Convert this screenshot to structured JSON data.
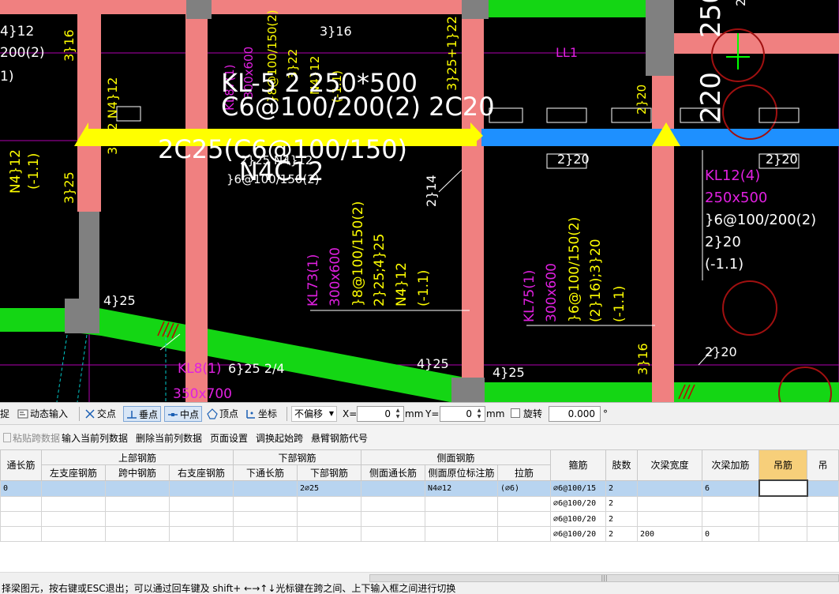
{
  "canvas": {
    "labels": {
      "tl_1": "4}12",
      "tl_2": "200(2)",
      "tl_3": "1)",
      "col1_top": "3}16",
      "col2_top_a": "3}16",
      "col3_top": "3}25+1}22",
      "n4_12_v": "N4}12",
      "n4_12_v2": "3}22 N4}12",
      "left_n4_a": "N4}12",
      "left_n4_b": "(-1.1)",
      "left_3_25": "3}25",
      "ll1": "LL1",
      "kl_main_1": "KL-5 2 250*500",
      "kl_main_2": "C6@100/200(2) 2C20",
      "kl_main_3": "2C25(C6@100/150)",
      "kl_main_4": "N4C12",
      "kl_small_1": "2}25 N4}12",
      "kl_small_2": "}6@100/150(2)",
      "kl7_1": "KL87(1)",
      "kl7_2": "300x600",
      "kl7_3": "}8@100/150(2)",
      "kl7_4": "3}22",
      "kl7_5": "N4}12",
      "kl7_6": "(-1.1)",
      "r220": "220",
      "r250": "250",
      "r2_20_top": "2}20,2}20",
      "mid_2_20": "2}20",
      "right_2_20": "2}20",
      "kl12_1": "KL12(4)",
      "kl12_2": "250x500",
      "kl12_3": "}6@100/200(2)",
      "kl12_4": "2}20",
      "kl12_5": "(-1.1)",
      "lbl_2_14": "2}14",
      "kl73_1": "KL73(1)",
      "kl73_2": "300x600",
      "kl73_3": "}8@100/150(2)",
      "kl73_4": "2}25;4}25",
      "kl73_5": "N4}12",
      "kl73_6": "(-1.1)",
      "kl75_1": "KL75(1)",
      "kl75_2": "300x600",
      "kl75_3": "}6@100/150(2)",
      "kl75_4": "(2}16);3}20",
      "kl75_5": "(-1.1)",
      "r3_16": "3}16",
      "br_2_20": "2}20",
      "bl_4_25": "4}25",
      "kl8_1": "KL8(1)",
      "kl8_2": "350x700",
      "lbl_6_25": "6}25 2/4",
      "lbl_4_25_mid": "4}25",
      "lbl_4_25_r": "4}25"
    }
  },
  "toolbar": {
    "items": [
      {
        "label": "捉",
        "icon": "snap-icon"
      },
      {
        "label": "动态输入",
        "icon": "dynamic-input-icon"
      },
      {
        "label": "交点",
        "icon": "intersection-icon"
      },
      {
        "label": "垂点",
        "icon": "perpendicular-icon"
      },
      {
        "label": "中点",
        "icon": "midpoint-icon"
      },
      {
        "label": "顶点",
        "icon": "vertex-icon"
      },
      {
        "label": "坐标",
        "icon": "coordinate-icon"
      }
    ],
    "offset_mode": "不偏移",
    "x_label": "X=",
    "x_value": "0",
    "y_label": "Y=",
    "y_value": "0",
    "unit_mm": "mm",
    "rotate_label": "旋转",
    "rotate_value": "0.000",
    "degree": "°"
  },
  "menubar": {
    "items": [
      {
        "label": "粘贴跨数据",
        "enabled": false
      },
      {
        "label": "输入当前列数据",
        "enabled": true
      },
      {
        "label": "删除当前列数据",
        "enabled": true
      },
      {
        "label": "页面设置",
        "enabled": true
      },
      {
        "label": "调换起始跨",
        "enabled": true
      },
      {
        "label": "悬臂钢筋代号",
        "enabled": true
      }
    ]
  },
  "grid": {
    "groups": {
      "top": "上部钢筋",
      "bottom": "下部钢筋",
      "side": "侧面钢筋"
    },
    "columns": {
      "c0": "通长筋",
      "c1": "左支座钢筋",
      "c2": "跨中钢筋",
      "c3": "右支座钢筋",
      "c4": "下通长筋",
      "c5": "下部钢筋",
      "c6": "侧面通长筋",
      "c7": "侧面原位标注筋",
      "c8": "拉筋",
      "c9": "箍筋",
      "c10": "肢数",
      "c11": "次梁宽度",
      "c12": "次梁加筋",
      "c13": "吊筋",
      "c14": "吊"
    },
    "rows": [
      [
        "0",
        "",
        "",
        "",
        "",
        "2⌀25",
        "",
        "N4⌀12",
        "(⌀6)",
        "⌀6@100/15",
        "2",
        "",
        "6",
        "",
        ""
      ],
      [
        "",
        "",
        "",
        "",
        "",
        "",
        "",
        "",
        "",
        "⌀6@100/20",
        "2",
        "",
        "",
        "",
        ""
      ],
      [
        "",
        "",
        "",
        "",
        "",
        "",
        "",
        "",
        "",
        "⌀6@100/20",
        "2",
        "",
        "",
        "",
        ""
      ],
      [
        "",
        "",
        "",
        "",
        "",
        "",
        "",
        "",
        "",
        "⌀6@100/20",
        "2",
        "200",
        "0",
        "",
        ""
      ]
    ]
  },
  "scroll": {
    "thumb_grip": "|||"
  },
  "status": {
    "text": "择梁图元，按右键或ESC退出；可以通过回车键及 shift+ ←→↑↓光标键在跨之间、上下输入框之间进行切换"
  }
}
